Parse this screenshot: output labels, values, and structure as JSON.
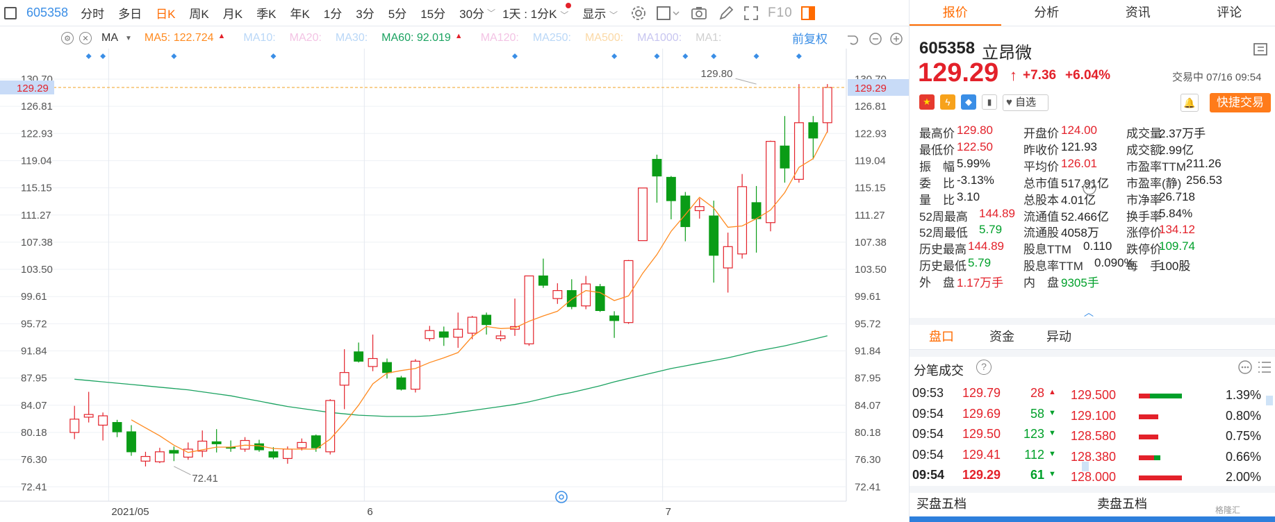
{
  "toolbar": {
    "code": "605358",
    "items": [
      "分时",
      "多日",
      "日K",
      "周K",
      "月K",
      "季K",
      "年K",
      "1分",
      "3分",
      "5分",
      "15分",
      "30分"
    ],
    "period_select": "1天 : 1分K",
    "display_label": "显示",
    "f10_label": "F10"
  },
  "ma_bar": {
    "label": "MA",
    "items": [
      {
        "text": "MA5: 122.724",
        "color": "#ff8a1f",
        "arrow": "▲"
      },
      {
        "text": "MA10:",
        "color": "#b9d7f7",
        "arrow": ""
      },
      {
        "text": "MA20:",
        "color": "#f3c3e4",
        "arrow": ""
      },
      {
        "text": "MA30:",
        "color": "#b9d7f7",
        "arrow": ""
      },
      {
        "text": "MA60: 92.019",
        "color": "#1aa260",
        "arrow": "▲"
      },
      {
        "text": "MA120:",
        "color": "#f3c3e4",
        "arrow": ""
      },
      {
        "text": "MA250:",
        "color": "#b9d7f7",
        "arrow": ""
      },
      {
        "text": "MA500:",
        "color": "#fbd9a6",
        "arrow": ""
      },
      {
        "text": "MA1000:",
        "color": "#c7c5f0",
        "arrow": ""
      },
      {
        "text": "MA1:",
        "color": "#cfcfcf",
        "arrow": ""
      }
    ],
    "adjust_label": "前复权"
  },
  "chart_data": {
    "type": "candlestick",
    "ylim": [
      70.0,
      132.0
    ],
    "y_ticks": [
      "130.70",
      "126.81",
      "122.93",
      "119.04",
      "115.15",
      "111.27",
      "107.38",
      "103.50",
      "99.61",
      "95.72",
      "91.84",
      "87.95",
      "84.07",
      "80.18",
      "76.30",
      "72.41"
    ],
    "x_labels": [
      {
        "index": 3,
        "text": "2021/05"
      },
      {
        "index": 21,
        "text": "6"
      },
      {
        "index": 42,
        "text": "7"
      }
    ],
    "current_price": 129.29,
    "current_price_label": "129.29",
    "annotations": [
      {
        "index": 7,
        "price": 72.41,
        "text": "72.41"
      },
      {
        "index": 48,
        "price": 129.8,
        "text": "129.80"
      }
    ],
    "markers": [
      1,
      2,
      7,
      14,
      31,
      38,
      41,
      43,
      45,
      48,
      51
    ],
    "candles": [
      {
        "o": 77.5,
        "h": 81.5,
        "l": 76.5,
        "c": 79.5
      },
      {
        "o": 79.8,
        "h": 83.6,
        "l": 79.0,
        "c": 80.2
      },
      {
        "o": 78.6,
        "h": 80.5,
        "l": 76.3,
        "c": 80.0
      },
      {
        "o": 79.0,
        "h": 79.4,
        "l": 76.8,
        "c": 77.6
      },
      {
        "o": 77.6,
        "h": 78.6,
        "l": 74.0,
        "c": 74.6
      },
      {
        "o": 73.2,
        "h": 74.6,
        "l": 72.4,
        "c": 73.9
      },
      {
        "o": 73.1,
        "h": 75.2,
        "l": 72.9,
        "c": 74.6
      },
      {
        "o": 74.8,
        "h": 75.4,
        "l": 73.2,
        "c": 74.4
      },
      {
        "o": 73.8,
        "h": 76.0,
        "l": 73.4,
        "c": 75.0
      },
      {
        "o": 74.7,
        "h": 77.8,
        "l": 73.8,
        "c": 76.2
      },
      {
        "o": 76.1,
        "h": 78.0,
        "l": 74.5,
        "c": 75.8
      },
      {
        "o": 75.3,
        "h": 76.3,
        "l": 74.6,
        "c": 75.2
      },
      {
        "o": 75.0,
        "h": 76.8,
        "l": 74.6,
        "c": 76.3
      },
      {
        "o": 75.8,
        "h": 76.4,
        "l": 74.6,
        "c": 74.9
      },
      {
        "o": 74.6,
        "h": 75.3,
        "l": 73.5,
        "c": 73.8
      },
      {
        "o": 73.6,
        "h": 75.4,
        "l": 72.8,
        "c": 75.0
      },
      {
        "o": 75.2,
        "h": 76.6,
        "l": 74.8,
        "c": 76.0
      },
      {
        "o": 77.0,
        "h": 77.2,
        "l": 74.6,
        "c": 75.2
      },
      {
        "o": 74.6,
        "h": 82.5,
        "l": 74.2,
        "c": 82.3
      },
      {
        "o": 84.6,
        "h": 90.0,
        "l": 81.0,
        "c": 86.5
      },
      {
        "o": 89.6,
        "h": 91.0,
        "l": 88.0,
        "c": 88.2
      },
      {
        "o": 87.4,
        "h": 92.2,
        "l": 86.7,
        "c": 88.6
      },
      {
        "o": 88.0,
        "h": 88.6,
        "l": 85.6,
        "c": 86.5
      },
      {
        "o": 85.7,
        "h": 86.0,
        "l": 83.8,
        "c": 84.0
      },
      {
        "o": 84.0,
        "h": 88.5,
        "l": 83.5,
        "c": 88.2
      },
      {
        "o": 91.6,
        "h": 93.5,
        "l": 91.2,
        "c": 92.8
      },
      {
        "o": 92.6,
        "h": 93.4,
        "l": 90.5,
        "c": 91.8
      },
      {
        "o": 91.8,
        "h": 95.5,
        "l": 90.2,
        "c": 93.0
      },
      {
        "o": 92.4,
        "h": 95.0,
        "l": 91.5,
        "c": 94.8
      },
      {
        "o": 95.1,
        "h": 95.5,
        "l": 92.2,
        "c": 93.7
      },
      {
        "o": 91.6,
        "h": 92.8,
        "l": 91.2,
        "c": 92.0
      },
      {
        "o": 93.0,
        "h": 97.6,
        "l": 92.0,
        "c": 93.4
      },
      {
        "o": 90.8,
        "h": 101.0,
        "l": 90.5,
        "c": 101.0
      },
      {
        "o": 101.0,
        "h": 103.6,
        "l": 99.2,
        "c": 99.6
      },
      {
        "o": 97.6,
        "h": 99.9,
        "l": 96.8,
        "c": 98.8
      },
      {
        "o": 98.8,
        "h": 100.5,
        "l": 96.0,
        "c": 96.4
      },
      {
        "o": 96.5,
        "h": 101.0,
        "l": 96.0,
        "c": 99.8
      },
      {
        "o": 99.4,
        "h": 99.8,
        "l": 95.6,
        "c": 95.8
      },
      {
        "o": 95.0,
        "h": 95.7,
        "l": 91.7,
        "c": 94.3
      },
      {
        "o": 94.0,
        "h": 103.4,
        "l": 93.8,
        "c": 103.3
      },
      {
        "o": 106.3,
        "h": 114.2,
        "l": 106.3,
        "c": 114.2
      },
      {
        "o": 118.5,
        "h": 119.2,
        "l": 112.0,
        "c": 116.0
      },
      {
        "o": 115.8,
        "h": 116.0,
        "l": 109.5,
        "c": 112.3
      },
      {
        "o": 113.0,
        "h": 113.6,
        "l": 106.2,
        "c": 108.4
      },
      {
        "o": 110.8,
        "h": 112.6,
        "l": 109.6,
        "c": 111.4
      },
      {
        "o": 110.0,
        "h": 112.3,
        "l": 100.0,
        "c": 104.1
      },
      {
        "o": 102.2,
        "h": 107.5,
        "l": 98.5,
        "c": 105.4
      },
      {
        "o": 104.3,
        "h": 116.3,
        "l": 103.6,
        "c": 114.4
      },
      {
        "o": 112.0,
        "h": 114.5,
        "l": 104.5,
        "c": 109.6
      },
      {
        "o": 109.0,
        "h": 121.3,
        "l": 107.7,
        "c": 121.2
      },
      {
        "o": 120.5,
        "h": 125.0,
        "l": 115.0,
        "c": 117.2
      },
      {
        "o": 115.5,
        "h": 129.8,
        "l": 115.0,
        "c": 124.0
      },
      {
        "o": 124.0,
        "h": 125.0,
        "l": 118.5,
        "c": 121.7
      },
      {
        "o": 124.0,
        "h": 129.8,
        "l": 122.5,
        "c": 129.29
      }
    ],
    "ma5": [
      null,
      null,
      null,
      null,
      79.4,
      78.2,
      77.0,
      75.6,
      74.5,
      74.9,
      75.3,
      75.3,
      75.6,
      75.5,
      75.1,
      75.0,
      75.0,
      75.0,
      76.5,
      78.9,
      81.6,
      84.8,
      86.4,
      86.8,
      87.1,
      88.0,
      88.7,
      89.5,
      91.9,
      93.4,
      93.1,
      93.2,
      94.2,
      95.0,
      95.7,
      97.5,
      98.8,
      98.5,
      97.3,
      98.0,
      101.4,
      104.2,
      107.7,
      110.2,
      112.8,
      111.2,
      108.3,
      108.5,
      109.6,
      110.9,
      113.5,
      117.3,
      118.6,
      122.7
    ],
    "ma60": [
      85.5,
      85.3,
      85.1,
      84.9,
      84.7,
      84.5,
      84.3,
      84.1,
      83.9,
      83.6,
      83.3,
      83.0,
      82.6,
      82.2,
      81.8,
      81.4,
      81.1,
      80.8,
      80.5,
      80.3,
      80.1,
      80.0,
      79.9,
      79.9,
      79.9,
      80.0,
      80.2,
      80.5,
      80.8,
      81.1,
      81.4,
      81.7,
      82.1,
      82.6,
      83.1,
      83.5,
      84.0,
      84.5,
      85.1,
      85.6,
      86.1,
      86.6,
      87.1,
      87.5,
      87.9,
      88.3,
      88.7,
      89.2,
      89.7,
      90.1,
      90.5,
      91.0,
      91.5,
      92.019
    ]
  },
  "quote": {
    "code": "605358",
    "name": "立昂微",
    "price": "129.29",
    "change": "+7.36",
    "pct": "+6.04%",
    "status": "交易中 07/16 09:54",
    "watch_label": "自选",
    "trade_label": "快捷交易",
    "fields": [
      [
        {
          "k": "最高价",
          "v": "129.80",
          "c": "red"
        },
        {
          "k": "开盘价",
          "v": "124.00",
          "c": "red"
        },
        {
          "k": "成交量",
          "v": "2.37万手",
          "c": "dark"
        }
      ],
      [
        {
          "k": "最低价",
          "v": "122.50",
          "c": "red"
        },
        {
          "k": "昨收价",
          "v": "121.93",
          "c": "dark"
        },
        {
          "k": "成交额",
          "v": "2.99亿",
          "c": "dark"
        }
      ],
      [
        {
          "k": "振　幅",
          "v": "5.99%",
          "c": "dark"
        },
        {
          "k": "平均价",
          "v": "126.01",
          "c": "red"
        },
        {
          "k": "市盈率TTM",
          "v": "211.26",
          "c": "dark"
        }
      ],
      [
        {
          "k": "委　比",
          "v": "-3.13%",
          "c": "dark"
        },
        {
          "k": "总市值",
          "v": "517.91亿",
          "c": "dark"
        },
        {
          "k": "市盈率(静)",
          "v": "256.53",
          "c": "dark"
        }
      ],
      [
        {
          "k": "量　比",
          "v": "3.10",
          "c": "dark"
        },
        {
          "k": "总股本",
          "v": "4.01亿",
          "c": "dark"
        },
        {
          "k": "市净率",
          "v": "26.718",
          "c": "dark"
        }
      ],
      [
        {
          "k": "52周最高",
          "v": "144.89",
          "c": "red"
        },
        {
          "k": "流通值",
          "v": "52.466亿",
          "c": "dark"
        },
        {
          "k": "换手率",
          "v": "5.84%",
          "c": "dark"
        }
      ],
      [
        {
          "k": "52周最低",
          "v": "5.79",
          "c": "green"
        },
        {
          "k": "流通股",
          "v": "4058万",
          "c": "dark"
        },
        {
          "k": "涨停价",
          "v": "134.12",
          "c": "red"
        }
      ],
      [
        {
          "k": "历史最高",
          "v": "144.89",
          "c": "red"
        },
        {
          "k": "股息TTM",
          "v": "0.110",
          "c": "dark"
        },
        {
          "k": "跌停价",
          "v": "109.74",
          "c": "green"
        }
      ],
      [
        {
          "k": "历史最低",
          "v": "5.79",
          "c": "green"
        },
        {
          "k": "股息率TTM",
          "v": "0.090%",
          "c": "dark"
        },
        {
          "k": "每　手",
          "v": "100股",
          "c": "dark"
        }
      ],
      [
        {
          "k": "外　盘",
          "v": "1.17万手",
          "c": "red"
        },
        {
          "k": "内　盘",
          "v": "9305手",
          "c": "green"
        },
        {
          "k": "",
          "v": "",
          "c": "dark"
        }
      ]
    ]
  },
  "right_tabs": [
    "报价",
    "分析",
    "资讯",
    "评论"
  ],
  "sub_tabs": [
    "盘口",
    "资金",
    "异动"
  ],
  "ticks": {
    "title": "分笔成交",
    "rows": [
      {
        "time": "09:53",
        "price": "129.79",
        "vol": "28",
        "dir": "up"
      },
      {
        "time": "09:54",
        "price": "129.69",
        "vol": "58",
        "dir": "down"
      },
      {
        "time": "09:54",
        "price": "129.50",
        "vol": "123",
        "dir": "down"
      },
      {
        "time": "09:54",
        "price": "129.41",
        "vol": "112",
        "dir": "down"
      },
      {
        "time": "09:54",
        "price": "129.29",
        "vol": "61",
        "dir": "down"
      }
    ],
    "levels": [
      {
        "price": "129.500",
        "pct": "1.39%",
        "red": 0.25,
        "green": 0.75
      },
      {
        "price": "129.100",
        "pct": "0.80%",
        "red": 0.45,
        "green": 0.0
      },
      {
        "price": "128.580",
        "pct": "0.75%",
        "red": 0.45,
        "green": 0.0
      },
      {
        "price": "128.380",
        "pct": "0.66%",
        "red": 0.35,
        "green": 0.15
      },
      {
        "price": "128.000",
        "pct": "2.00%",
        "red": 1.0,
        "green": 0.0
      }
    ]
  },
  "book": {
    "buy_label": "买盘五档",
    "sell_label": "卖盘五档"
  }
}
